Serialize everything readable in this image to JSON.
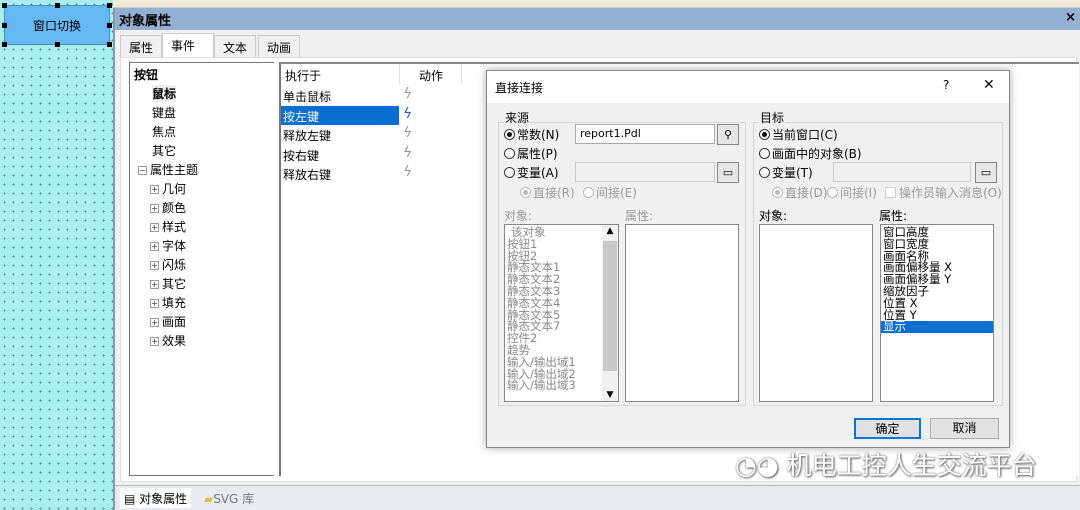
{
  "canvas": {
    "button_label": "窗口切换"
  },
  "panel": {
    "title": "对象属性",
    "close": "×",
    "tabs": [
      "属性",
      "事件",
      "文本",
      "动画"
    ],
    "tree": {
      "root": "按钮",
      "children": [
        "鼠标",
        "键盘",
        "焦点",
        "其它"
      ],
      "group": "属性主题",
      "group_children": [
        "几何",
        "颜色",
        "样式",
        "字体",
        "闪烁",
        "其它",
        "填充",
        "画面",
        "效果"
      ]
    },
    "events": {
      "col_exec": "执行于",
      "col_action": "动作",
      "rows": [
        "单击鼠标",
        "按左键",
        "释放左键",
        "按右键",
        "释放右键"
      ],
      "selected": 1
    },
    "bottom_tabs": [
      "对象属性",
      "SVG 库"
    ]
  },
  "dialog": {
    "title": "直接连接",
    "help": "?",
    "close": "✕",
    "source": {
      "label": "来源",
      "constant": "常数(N)",
      "constant_value": "report1.Pdl",
      "property": "属性(P)",
      "variable": "变量(A)",
      "direct": "直接(R)",
      "indirect": "间接(E)",
      "object_label": "对象:",
      "property_label": "属性:",
      "objects": [
        "该对象",
        "按钮1",
        "按钮2",
        "静态文本1",
        "静态文本2",
        "静态文本3",
        "静态文本4",
        "静态文本5",
        "静态文本7",
        "控件2",
        "趋势",
        "输入/输出域1",
        "输入/输出域2",
        "输入/输出域3"
      ]
    },
    "target": {
      "label": "目标",
      "current_window": "当前窗口(C)",
      "object_in_screen": "画面中的对象(B)",
      "variable": "变量(T)",
      "direct": "直接(D)",
      "indirect": "间接(I)",
      "operator_msg": "操作员输入消息(O)",
      "object_label": "对象:",
      "property_label": "属性:",
      "properties": [
        "窗口高度",
        "窗口宽度",
        "画面名称",
        "画面偏移量 X",
        "画面偏移量 Y",
        "缩放因子",
        "位置 X",
        "位置 Y",
        "显示"
      ],
      "selected": 8
    },
    "ok": "确定",
    "cancel": "取消"
  },
  "watermark": "机电工控人生交流平台",
  "colors": {
    "selection": "#0a6fd0",
    "titlebar": "#93b0d2",
    "canvas": "#a8eef0"
  }
}
